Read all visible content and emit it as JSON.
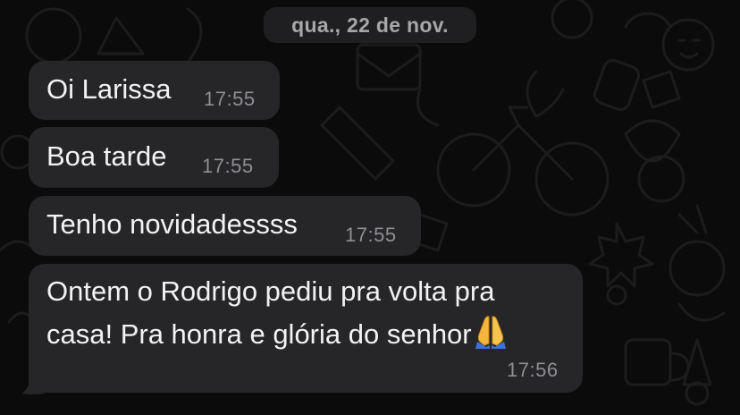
{
  "date_separator": "qua., 22 de nov.",
  "messages": [
    {
      "text": "Oi Larissa",
      "time": "17:55"
    },
    {
      "text": "Boa tarde",
      "time": "17:55"
    },
    {
      "text": "Tenho novidadessss",
      "time": "17:55"
    },
    {
      "line1": "Ontem o Rodrigo pediu pra volta pra",
      "line2": "casa! Pra honra e glória do senhor",
      "emoji": "folded-hands-icon",
      "time": "17:56"
    }
  ],
  "colors": {
    "background": "#0b0b0b",
    "bubble": "#262628",
    "text": "#f2f2f4",
    "timestamp": "#8e8e93",
    "date_chip": "#1f1f21"
  }
}
